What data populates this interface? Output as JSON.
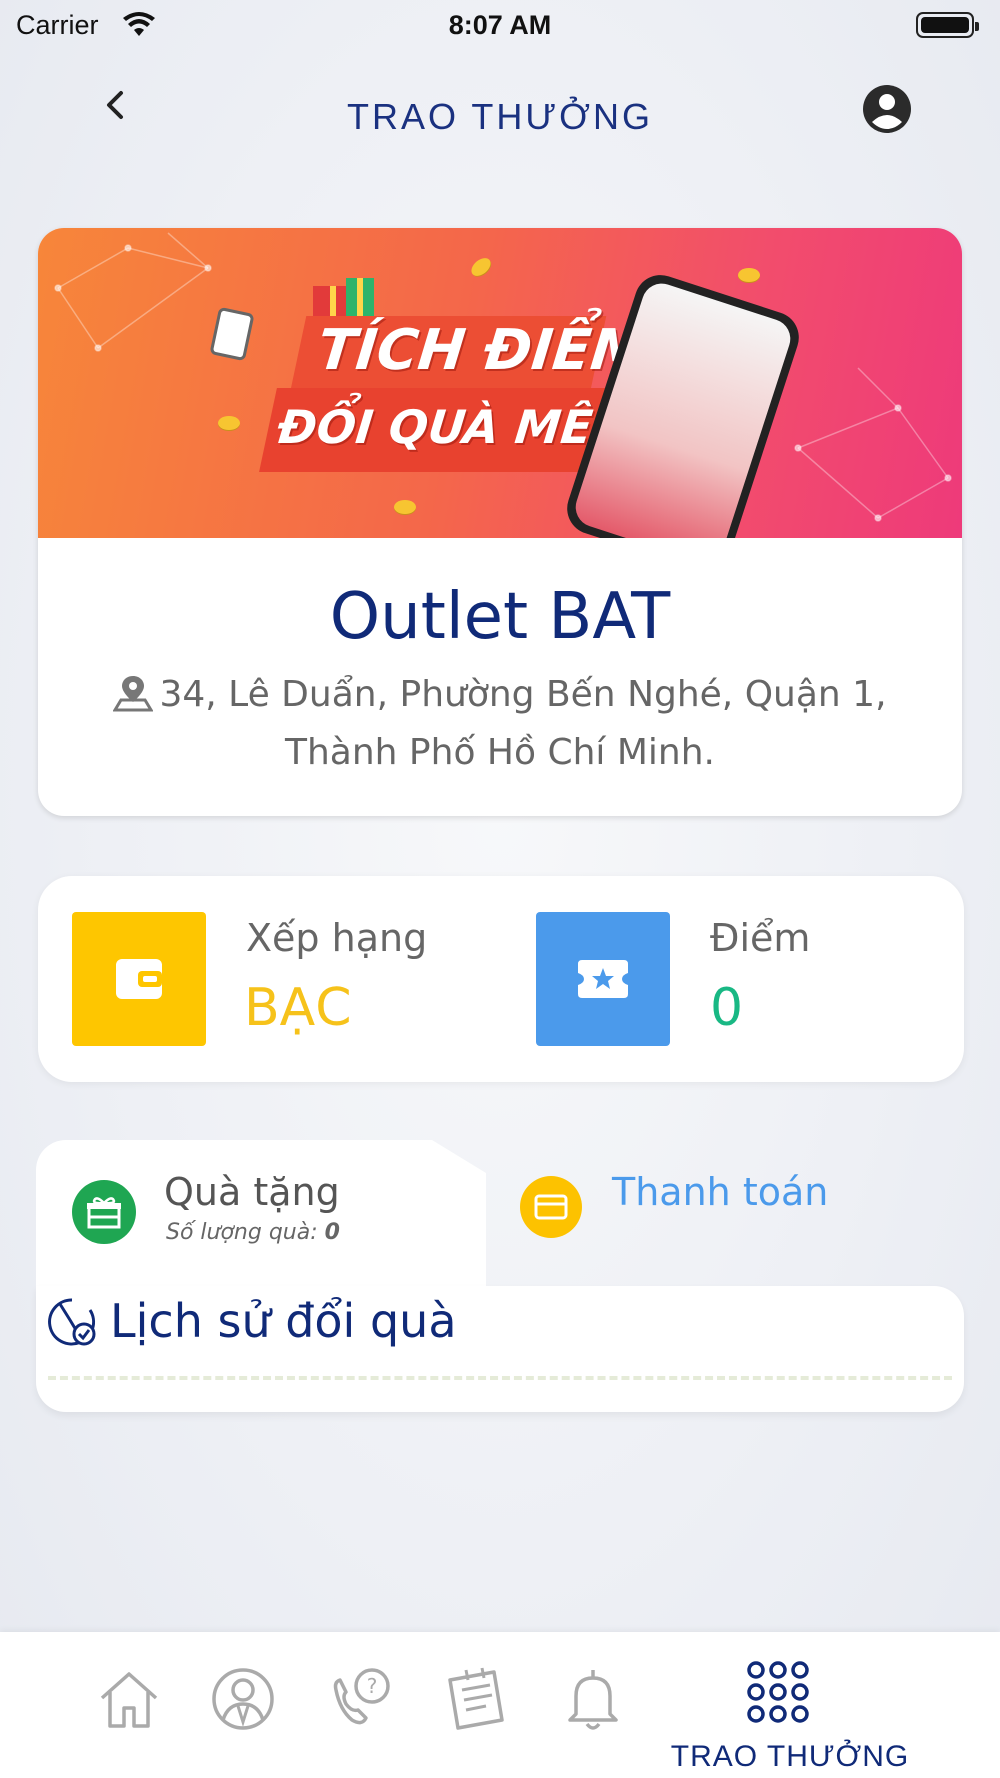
{
  "status_bar": {
    "carrier": "Carrier",
    "time": "8:07 AM"
  },
  "header": {
    "title": "TRAO THƯỞNG"
  },
  "banner": {
    "line1": "TÍCH ĐIỂM",
    "line2": "ĐỔI QUÀ MÊ LY"
  },
  "outlet": {
    "name": "Outlet BAT",
    "address": "34, Lê Duẩn, Phường Bến Nghé, Quận 1, Thành Phố Hồ Chí Minh."
  },
  "stats": {
    "rank_label": "Xếp hạng",
    "rank_value": "BẠC",
    "points_label": "Điểm",
    "points_value": "0"
  },
  "tabs": {
    "gift": {
      "title": "Quà tặng",
      "sub_label": "Số lượng quà:",
      "sub_value": "0"
    },
    "payment": {
      "title": "Thanh toán"
    }
  },
  "history": {
    "title": "Lịch sử đổi quà"
  },
  "bottom_nav": {
    "active_label": "TRAO THƯỞNG"
  },
  "colors": {
    "primary": "#102a78",
    "rank": "#f6c21a",
    "points": "#19b884",
    "tile_rank": "#fec600",
    "tile_points": "#4b9aeb",
    "gift_icon": "#1fa652"
  }
}
